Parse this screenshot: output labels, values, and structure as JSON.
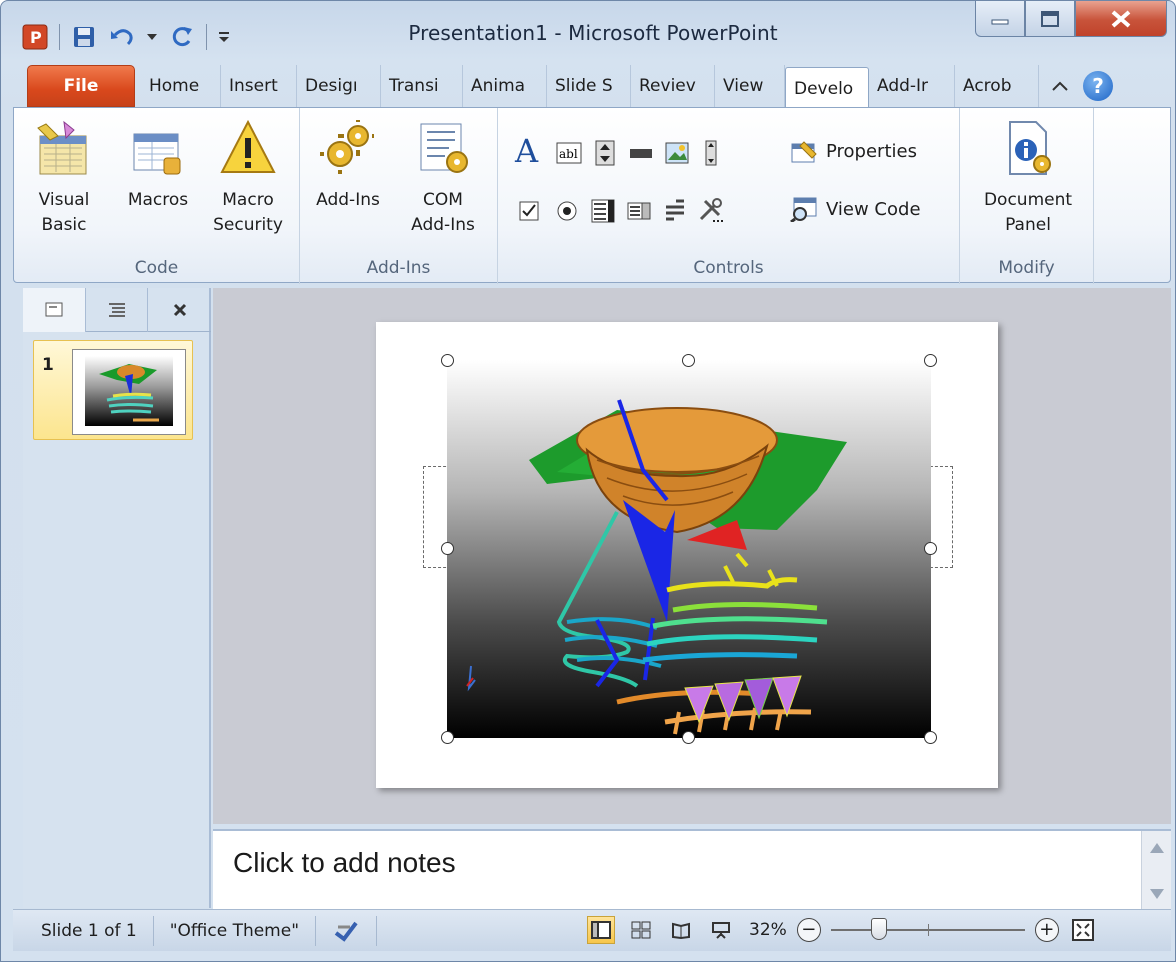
{
  "window": {
    "title": "Presentation1 - Microsoft PowerPoint"
  },
  "tabs": {
    "file": "File",
    "items": [
      "Home",
      "Insert",
      "Desigı",
      "Transi",
      "Anima",
      "Slide S",
      "Reviev",
      "View",
      "Develo",
      "Add-Ir",
      "Acrob"
    ]
  },
  "ribbon": {
    "code": {
      "label": "Code",
      "visual_basic": [
        "Visual",
        "Basic"
      ],
      "macros": "Macros",
      "macro_security": [
        "Macro",
        "Security"
      ]
    },
    "addins": {
      "label": "Add-Ins",
      "addins": "Add-Ins",
      "com_addins": [
        "COM",
        "Add-Ins"
      ]
    },
    "controls": {
      "label": "Controls",
      "properties": "Properties",
      "view_code": "View Code"
    },
    "modify": {
      "label": "Modify",
      "document_panel": [
        "Document",
        "Panel"
      ]
    }
  },
  "thumbnails": {
    "slide_number": "1"
  },
  "notes": {
    "placeholder": "Click to add notes"
  },
  "status": {
    "slide": "Slide 1 of 1",
    "theme": "\"Office Theme\"",
    "zoom": "32%",
    "zoom_level": 32
  },
  "colors": {
    "file_tab": "#d9481c",
    "active_view": "#f7c64a",
    "chrome": "#d4e1ef"
  }
}
